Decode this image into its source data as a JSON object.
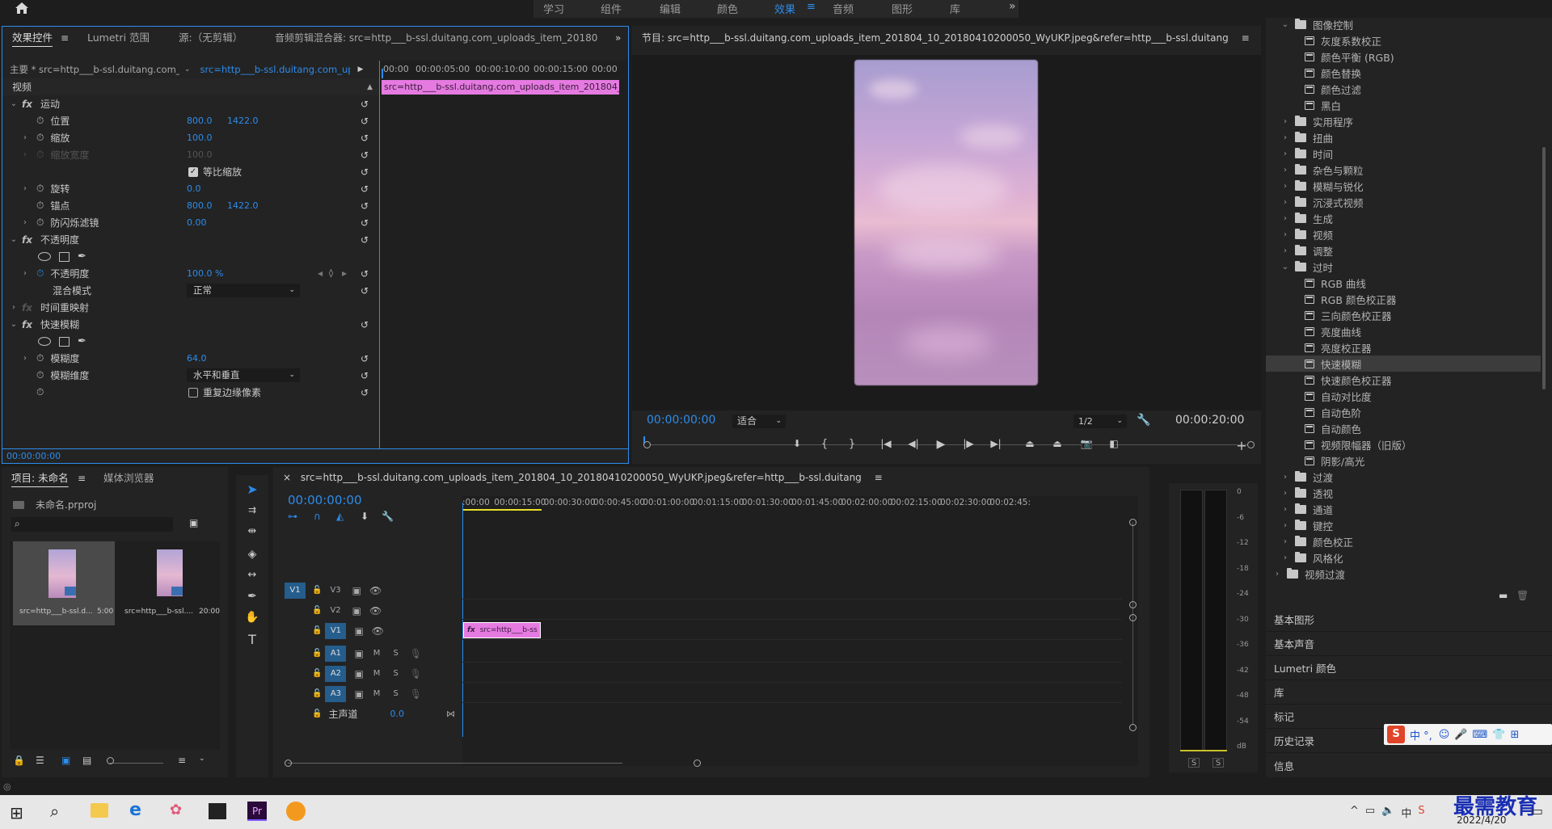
{
  "topbar": {
    "workspaces": [
      "学习",
      "组件",
      "编辑",
      "颜色",
      "效果",
      "音频",
      "图形",
      "库"
    ],
    "active": "效果"
  },
  "effect_controls": {
    "tabs": [
      "效果控件",
      "Lumetri 范围",
      "源:（无剪辑）",
      "音频剪辑混合器: src=http___b-ssl.duitang.com_uploads_item_201804_10_201"
    ],
    "master_label": "主要 * src=http___b-ssl.duitang.com_up...",
    "clip_label": "src=http___b-ssl.duitang.com_uploa...",
    "time_marks": [
      "00:00",
      "00:00:05:00",
      "00:00:10:00",
      "00:00:15:00",
      "00:00"
    ],
    "clip_bar": "src=http___b-ssl.duitang.com_uploads_item_201804_10_",
    "section_video": "视频",
    "motion": "运动",
    "position_label": "位置",
    "position_x": "800.0",
    "position_y": "1422.0",
    "scale_label": "缩放",
    "scale_value": "100.0",
    "scale_width_label": "缩放宽度",
    "scale_width_value": "100.0",
    "uniform_label": "等比缩放",
    "rotation_label": "旋转",
    "rotation_value": "0.0",
    "anchor_label": "锚点",
    "anchor_x": "800.0",
    "anchor_y": "1422.0",
    "antiflicker_label": "防闪烁滤镜",
    "antiflicker_value": "0.00",
    "opacity_section": "不透明度",
    "opacity_label": "不透明度",
    "opacity_value": "100.0 %",
    "blend_label": "混合模式",
    "blend_value": "正常",
    "time_remap": "时间重映射",
    "fast_blur": "快速模糊",
    "blurriness_label": "模糊度",
    "blurriness_value": "64.0",
    "blur_dim_label": "模糊维度",
    "blur_dim_value": "水平和垂直",
    "repeat_edge_label": "重复边缘像素",
    "timecode": "00:00:00:00",
    "fx": "fx"
  },
  "program": {
    "title": "节目: src=http___b-ssl.duitang.com_uploads_item_201804_10_20180410200050_WyUKP.jpeg&refer=http___b-ssl.duitang",
    "timecode": "00:00:00:00",
    "fit": "适合",
    "quality": "1/2",
    "duration": "00:00:20:00"
  },
  "effects_tree": {
    "items": [
      {
        "type": "folder-open",
        "label": "图像控制",
        "indent": 1
      },
      {
        "type": "fx",
        "label": "灰度系数校正",
        "indent": 2
      },
      {
        "type": "fx",
        "label": "颜色平衡 (RGB)",
        "indent": 2
      },
      {
        "type": "fx",
        "label": "颜色替换",
        "indent": 2
      },
      {
        "type": "fx",
        "label": "颜色过滤",
        "indent": 2
      },
      {
        "type": "fx",
        "label": "黑白",
        "indent": 2
      },
      {
        "type": "folder",
        "label": "实用程序",
        "indent": 1
      },
      {
        "type": "folder",
        "label": "扭曲",
        "indent": 1
      },
      {
        "type": "folder",
        "label": "时间",
        "indent": 1
      },
      {
        "type": "folder",
        "label": "杂色与颗粒",
        "indent": 1
      },
      {
        "type": "folder",
        "label": "模糊与锐化",
        "indent": 1
      },
      {
        "type": "folder",
        "label": "沉浸式视频",
        "indent": 1
      },
      {
        "type": "folder",
        "label": "生成",
        "indent": 1
      },
      {
        "type": "folder",
        "label": "视频",
        "indent": 1
      },
      {
        "type": "folder",
        "label": "调整",
        "indent": 1
      },
      {
        "type": "folder-open",
        "label": "过时",
        "indent": 1
      },
      {
        "type": "fx",
        "label": "RGB 曲线",
        "indent": 2
      },
      {
        "type": "fx",
        "label": "RGB 颜色校正器",
        "indent": 2
      },
      {
        "type": "fx",
        "label": "三向颜色校正器",
        "indent": 2
      },
      {
        "type": "fx",
        "label": "亮度曲线",
        "indent": 2
      },
      {
        "type": "fx",
        "label": "亮度校正器",
        "indent": 2
      },
      {
        "type": "fx",
        "label": "快速模糊",
        "indent": 2,
        "selected": true
      },
      {
        "type": "fx",
        "label": "快速颜色校正器",
        "indent": 2
      },
      {
        "type": "fx",
        "label": "自动对比度",
        "indent": 2
      },
      {
        "type": "fx",
        "label": "自动色阶",
        "indent": 2
      },
      {
        "type": "fx",
        "label": "自动颜色",
        "indent": 2
      },
      {
        "type": "fx",
        "label": "视频限幅器（旧版）",
        "indent": 2
      },
      {
        "type": "fx",
        "label": "阴影/高光",
        "indent": 2
      },
      {
        "type": "folder",
        "label": "过渡",
        "indent": 1
      },
      {
        "type": "folder",
        "label": "透视",
        "indent": 1
      },
      {
        "type": "folder",
        "label": "通道",
        "indent": 1
      },
      {
        "type": "folder",
        "label": "键控",
        "indent": 1
      },
      {
        "type": "folder",
        "label": "颜色校正",
        "indent": 1
      },
      {
        "type": "folder",
        "label": "风格化",
        "indent": 1
      },
      {
        "type": "folder",
        "label": "视频过渡",
        "indent": 0
      }
    ],
    "panels": [
      "基本图形",
      "基本声音",
      "Lumetri 颜色",
      "库",
      "标记",
      "历史记录",
      "信息"
    ]
  },
  "project": {
    "tabs": [
      "项目: 未命名",
      "媒体浏览器"
    ],
    "file": "未命名.prproj",
    "thumbs": [
      {
        "name": "src=http___b-ssl.d...",
        "dur": "5:00"
      },
      {
        "name": "src=http___b-ssl....",
        "dur": "20:00"
      }
    ]
  },
  "timeline": {
    "title": "src=http___b-ssl.duitang.com_uploads_item_201804_10_20180410200050_WyUKP.jpeg&refer=http___b-ssl.duitang",
    "timecode": "00:00:00:00",
    "ruler": [
      ":00:00",
      "00:00:15:00",
      "00:00:30:00",
      "00:00:45:00",
      "00:01:00:00",
      "00:01:15:00",
      "00:01:30:00",
      "00:01:45:00",
      "00:02:00:00",
      "00:02:15:00",
      "00:02:30:00",
      "00:02:45:"
    ],
    "video_tracks": [
      "V3",
      "V2",
      "V1"
    ],
    "audio_tracks": [
      "A1",
      "A2",
      "A3"
    ],
    "src_target": "V1",
    "master": "主声道",
    "master_value": "0.0",
    "clip": "src=http___b-ss",
    "m": "M",
    "s": "S"
  },
  "meter": {
    "scale": [
      "0",
      "-6",
      "-12",
      "-18",
      "-24",
      "-30",
      "-36",
      "-42",
      "-48",
      "-54",
      "dB"
    ],
    "solo": [
      "S",
      "S"
    ]
  },
  "ime": {
    "label": "中 °,"
  },
  "taskbar": {
    "brand": "最需教育",
    "date": "2022/4/20"
  },
  "colors": {
    "accent": "#2d8ceb",
    "clip": "#e57ae1",
    "selected": "#3c3c3c"
  }
}
